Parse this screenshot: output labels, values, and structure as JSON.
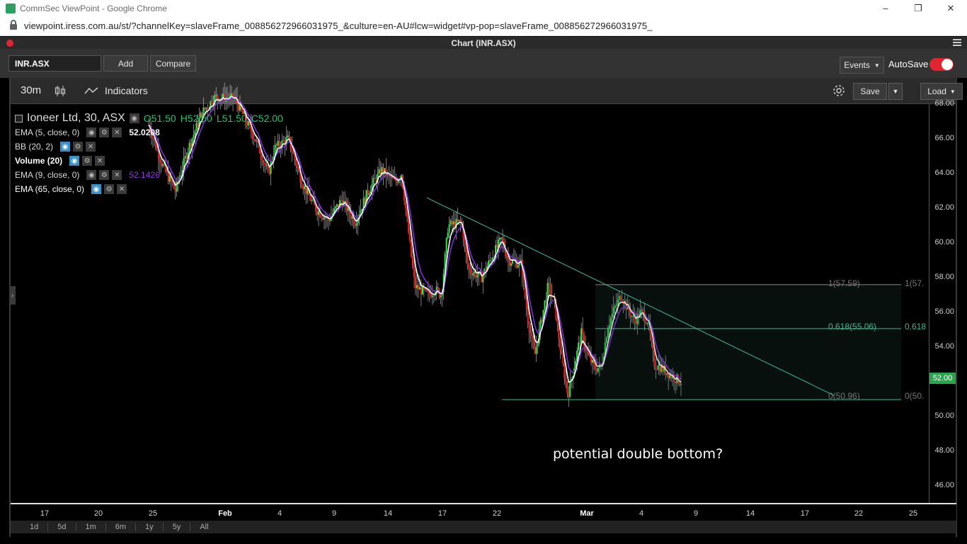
{
  "browser": {
    "tab_title": "CommSec ViewPoint - Google Chrome",
    "url": "viewpoint.iress.com.au/st/?channelKey=slaveFrame_008856272966031975_&culture=en-AU#lcw=widget#vp-pop=slaveFrame_008856272966031975_",
    "controls": [
      "–",
      "❐",
      "✕"
    ]
  },
  "app": {
    "title": "Chart (INR.ASX)",
    "symbol": "INR.ASX",
    "add_label": "Add",
    "compare_label": "Compare",
    "events_label": "Events",
    "autosave_label": "AutoSave",
    "autosave_on": true
  },
  "chart_toolbar": {
    "timeframe": "30m",
    "indicators_label": "Indicators",
    "save_label": "Save",
    "load_label": "Load"
  },
  "legend": {
    "instrument": "Ioneer Ltd, 30, ASX",
    "open": "O51.50",
    "high": "H52.50",
    "low": "L51.50",
    "close": "C52.00",
    "studies": [
      {
        "name": "EMA (5, close, 0)",
        "value": "52.0208"
      },
      {
        "name": "BB (20, 2)",
        "value": ""
      },
      {
        "name": "Volume (20)",
        "value": ""
      },
      {
        "name": "EMA (9, close, 0)",
        "value": "52.1426"
      },
      {
        "name": "EMA (65, close, 0)",
        "value": ""
      }
    ]
  },
  "annotation": "potential double bottom?",
  "fib": {
    "level_1": "1(57.59)",
    "level_1_right": "1(57.",
    "level_0618": "0.618(55.06)",
    "level_0618_right": "0.618",
    "level_0": "0(50.96)",
    "level_0_right": "0(50."
  },
  "current_price": "52.00",
  "range_buttons": [
    "1d",
    "5d",
    "1m",
    "6m",
    "1y",
    "5y",
    "All"
  ],
  "chart_data": {
    "type": "candlestick",
    "title": "Ioneer Ltd, 30, ASX",
    "ylim": [
      45,
      68
    ],
    "y_ticks": [
      "68.00",
      "66.00",
      "64.00",
      "62.00",
      "60.00",
      "58.00",
      "56.00",
      "54.00",
      "52.00",
      "50.00",
      "48.00",
      "46.00"
    ],
    "x_ticks": [
      "17",
      "20",
      "25",
      "Feb",
      "4",
      "9",
      "14",
      "17",
      "22",
      "Mar",
      "4",
      "9",
      "14",
      "17",
      "22",
      "25"
    ],
    "price_path": [
      [
        0.0,
        66.8
      ],
      [
        0.02,
        64.5
      ],
      [
        0.04,
        63.0
      ],
      [
        0.06,
        65.5
      ],
      [
        0.08,
        67.5
      ],
      [
        0.1,
        68.4
      ],
      [
        0.13,
        68.3
      ],
      [
        0.16,
        66.0
      ],
      [
        0.18,
        64.0
      ],
      [
        0.19,
        65.5
      ],
      [
        0.21,
        66.0
      ],
      [
        0.23,
        63.5
      ],
      [
        0.25,
        62.0
      ],
      [
        0.27,
        61.3
      ],
      [
        0.29,
        62.5
      ],
      [
        0.31,
        61.2
      ],
      [
        0.33,
        63.0
      ],
      [
        0.35,
        64.2
      ],
      [
        0.37,
        63.5
      ],
      [
        0.38,
        64.0
      ],
      [
        0.4,
        57.5
      ],
      [
        0.42,
        57.0
      ],
      [
        0.43,
        57.3
      ],
      [
        0.44,
        57.0
      ],
      [
        0.45,
        61.0
      ],
      [
        0.47,
        61.2
      ],
      [
        0.48,
        58.5
      ],
      [
        0.5,
        58.0
      ],
      [
        0.52,
        59.5
      ],
      [
        0.53,
        60.2
      ],
      [
        0.54,
        59.0
      ],
      [
        0.56,
        58.8
      ],
      [
        0.57,
        55.5
      ],
      [
        0.58,
        53.5
      ],
      [
        0.6,
        57.5
      ],
      [
        0.61,
        56.5
      ],
      [
        0.62,
        53.5
      ],
      [
        0.63,
        51.2
      ],
      [
        0.64,
        53.0
      ],
      [
        0.65,
        54.8
      ],
      [
        0.66,
        53.5
      ],
      [
        0.67,
        52.8
      ],
      [
        0.68,
        52.8
      ],
      [
        0.69,
        55.2
      ],
      [
        0.7,
        56.2
      ],
      [
        0.71,
        57.0
      ],
      [
        0.72,
        56.2
      ],
      [
        0.73,
        55.5
      ],
      [
        0.74,
        56.0
      ],
      [
        0.75,
        55.5
      ],
      [
        0.76,
        53.0
      ],
      [
        0.77,
        52.8
      ],
      [
        0.78,
        52.5
      ],
      [
        0.79,
        52.2
      ],
      [
        0.8,
        52.0
      ]
    ],
    "trendline": [
      [
        "2022-02-14",
        62.6
      ],
      [
        "2022-03-21",
        51.2
      ]
    ],
    "fib_retracement": {
      "high": 57.59,
      "low": 50.96,
      "levels": [
        1,
        0.618,
        0
      ]
    }
  }
}
